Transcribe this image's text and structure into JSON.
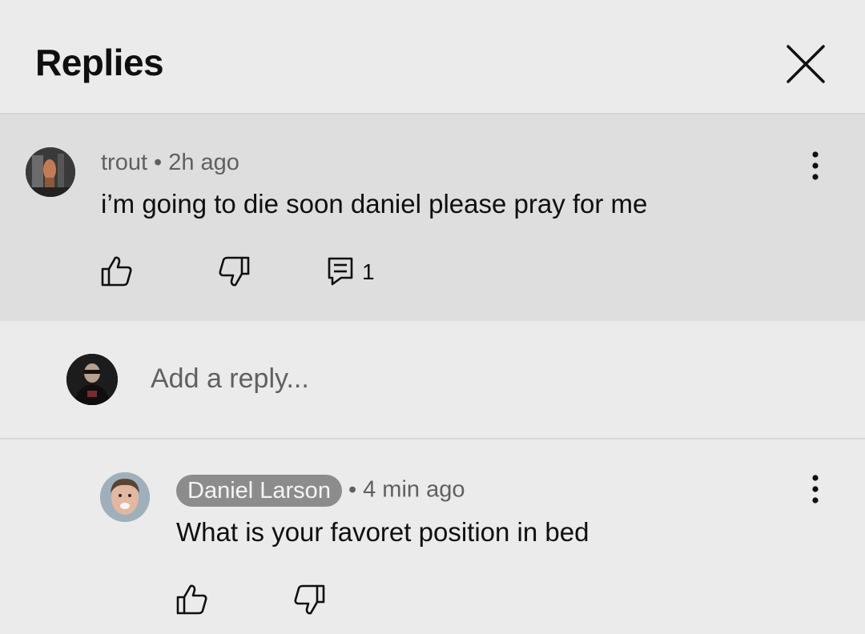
{
  "header": {
    "title": "Replies",
    "close_icon": "close-icon"
  },
  "parent_comment": {
    "author": "trout",
    "separator": "•",
    "time": "2h ago",
    "text": "i’m going to die soon daniel please pray for me",
    "reply_count": "1",
    "icons": [
      "like-icon",
      "dislike-icon",
      "reply-icon",
      "more-vert-icon"
    ]
  },
  "add_reply": {
    "placeholder": "Add a reply..."
  },
  "reply": {
    "author": "Daniel Larson",
    "separator": "•",
    "time": "4 min ago",
    "text": "What is your favoret position in bed",
    "icons": [
      "like-icon",
      "dislike-icon",
      "more-vert-icon"
    ]
  },
  "colors": {
    "background": "#ebebeb",
    "highlighted_comment_bg": "#dedede",
    "author_chip_bg": "#8c8c8c",
    "secondary_text": "#606060"
  }
}
